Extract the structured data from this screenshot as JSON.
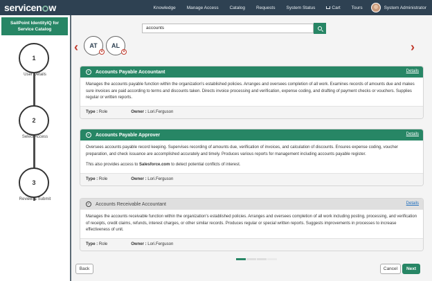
{
  "topbar": {
    "logo_prefix": "servicen",
    "logo_suffix": "w",
    "nav": [
      "Knowledge",
      "Manage Access",
      "Catalog",
      "Requests",
      "System Status",
      "Cart",
      "Tours"
    ],
    "user": "System Administrator"
  },
  "sidebar": {
    "title": "SailPoint IdentityIQ for Service Catalog",
    "steps": [
      {
        "number": "1",
        "label": "User Details"
      },
      {
        "number": "2",
        "label": "Select Access"
      },
      {
        "number": "3",
        "label": "Review & Submit"
      }
    ]
  },
  "search": {
    "value": "accounts"
  },
  "selected_identities": [
    "AT",
    "AL"
  ],
  "cards": [
    {
      "title": "Accounts Payable Accountant",
      "details": "Details",
      "description": "Manages the accounts payable function within the organization's established policies. Arranges and oversees completion of all work. Examines records of amounts due and makes sure invoices are paid according to terms and discounts taken. Directs invoice processing and verification, expense coding, and drafting of payment checks or vouchers. Supplies regular or written reports.",
      "extra_prefix": "",
      "extra_bold": "",
      "extra_suffix": "",
      "type_label": "Type :",
      "type": "Role",
      "owner_label": "Owner :",
      "owner": "Lori.Ferguson",
      "selected": true
    },
    {
      "title": "Accounts Payable Approver",
      "details": "Details",
      "description": "Oversees accounts payable record keeping. Supervises recording of amounts due, verification of invoices, and calculation of discounts. Ensures expense coding, voucher preparation, and check issuance are accomplished accurately and timely. Produces various reports for management including accounts payable register.",
      "extra_prefix": "This also provides access to ",
      "extra_bold": "Salesforce.com",
      "extra_suffix": " to detect potential conflicts of interest.",
      "type_label": "Type :",
      "type": "Role",
      "owner_label": "Owner :",
      "owner": "Lori.Ferguson",
      "selected": true
    },
    {
      "title": "Accounts Receivable Accountant",
      "details": "Details",
      "description": "Manages the accounts receivable function within the organization's established policies. Arranges and oversees completion of all work including posting, processing, and verification of receipts, credit claims, refunds, interest charges, or other similar records. Produces regular or special written reports. Suggests improvements in processes to increase effectiveness of unit.",
      "extra_prefix": "",
      "extra_bold": "",
      "extra_suffix": "",
      "type_label": "Type :",
      "type": "Role",
      "owner_label": "Owner :",
      "owner": "Lori.Ferguson",
      "selected": false
    }
  ],
  "buttons": {
    "back": "Back",
    "cancel": "Cancel",
    "next": "Next"
  },
  "colors": {
    "brand_green": "#278665",
    "topbar": "#2e4152",
    "arrow_red": "#c0392b"
  }
}
